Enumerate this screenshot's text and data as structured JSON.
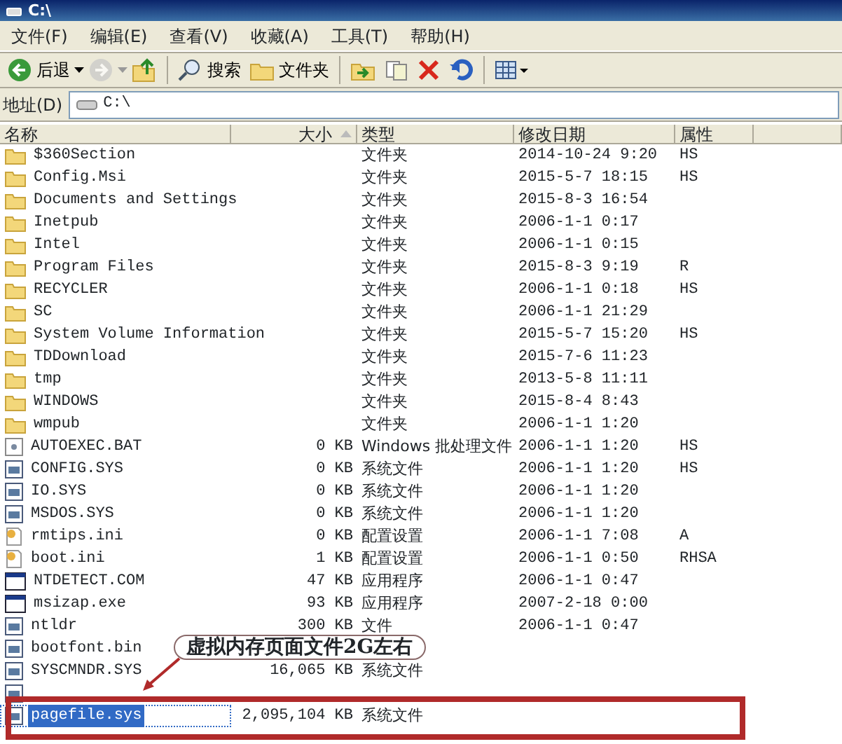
{
  "window": {
    "title": "C:\\"
  },
  "menu": [
    "文件(F)",
    "编辑(E)",
    "查看(V)",
    "收藏(A)",
    "工具(T)",
    "帮助(H)"
  ],
  "toolbar": [
    {
      "kind": "back",
      "label": "后退",
      "disabled": false
    },
    {
      "kind": "forward",
      "disabled": true
    },
    {
      "kind": "up"
    },
    {
      "kind": "sep"
    },
    {
      "kind": "search",
      "label": "搜索"
    },
    {
      "kind": "folders",
      "label": "文件夹"
    },
    {
      "kind": "sep"
    },
    {
      "kind": "moveto"
    },
    {
      "kind": "copyto"
    },
    {
      "kind": "delete"
    },
    {
      "kind": "undo"
    },
    {
      "kind": "sep"
    },
    {
      "kind": "views"
    }
  ],
  "address": {
    "label": "地址(D)",
    "value": "C:\\"
  },
  "columns": [
    "名称",
    "大小",
    "类型",
    "修改日期",
    "属性"
  ],
  "rows": [
    {
      "kind": "folder",
      "name": "$360Section",
      "type": "文件夹",
      "date": "2014-10-24 9:20",
      "attr": "HS",
      "selected": false
    },
    {
      "kind": "folder",
      "name": "Config.Msi",
      "type": "文件夹",
      "date": "2015-5-7 18:15",
      "attr": "HS",
      "selected": false
    },
    {
      "kind": "folder",
      "name": "Documents and Settings",
      "type": "文件夹",
      "date": "2015-8-3 16:54",
      "selected": false
    },
    {
      "kind": "folder",
      "name": "Inetpub",
      "type": "文件夹",
      "date": "2006-1-1 0:17",
      "selected": false
    },
    {
      "kind": "folder",
      "name": "Intel",
      "type": "文件夹",
      "date": "2006-1-1 0:15",
      "selected": false
    },
    {
      "kind": "folder",
      "name": "Program Files",
      "type": "文件夹",
      "date": "2015-8-3 9:19",
      "attr": "R",
      "selected": false
    },
    {
      "kind": "folder",
      "name": "RECYCLER",
      "type": "文件夹",
      "date": "2006-1-1 0:18",
      "attr": "HS",
      "selected": false
    },
    {
      "kind": "folder",
      "name": "SC",
      "type": "文件夹",
      "date": "2006-1-1 21:29",
      "selected": false
    },
    {
      "kind": "folder",
      "name": "System Volume Information",
      "type": "文件夹",
      "date": "2015-5-7 15:20",
      "attr": "HS",
      "selected": false
    },
    {
      "kind": "folder",
      "name": "TDDownload",
      "type": "文件夹",
      "date": "2015-7-6 11:23",
      "selected": false
    },
    {
      "kind": "folder",
      "name": "tmp",
      "type": "文件夹",
      "date": "2013-5-8 11:11",
      "selected": false
    },
    {
      "kind": "folder",
      "name": "WINDOWS",
      "type": "文件夹",
      "date": "2015-8-4 8:43",
      "selected": false
    },
    {
      "kind": "folder",
      "name": "wmpub",
      "type": "文件夹",
      "date": "2006-1-1 1:20",
      "selected": false
    },
    {
      "kind": "batch",
      "name": "AUTOEXEC.BAT",
      "size": "0 KB",
      "type": "Windows 批处理文件",
      "date": "2006-1-1 1:20",
      "attr": "HS",
      "selected": false
    },
    {
      "kind": "system",
      "name": "CONFIG.SYS",
      "size": "0 KB",
      "type": "系统文件",
      "date": "2006-1-1 1:20",
      "attr": "HS",
      "selected": false
    },
    {
      "kind": "system",
      "name": "IO.SYS",
      "size": "0 KB",
      "type": "系统文件",
      "date": "2006-1-1 1:20",
      "selected": false
    },
    {
      "kind": "system",
      "name": "MSDOS.SYS",
      "size": "0 KB",
      "type": "系统文件",
      "date": "2006-1-1 1:20",
      "selected": false
    },
    {
      "kind": "config",
      "name": "rmtips.ini",
      "size": "0 KB",
      "type": "配置设置",
      "date": "2006-1-1 7:08",
      "attr": "A",
      "selected": false
    },
    {
      "kind": "config",
      "name": "boot.ini",
      "size": "1 KB",
      "type": "配置设置",
      "date": "2006-1-1 0:50",
      "attr": "RHSA",
      "selected": false
    },
    {
      "kind": "app",
      "name": "NTDETECT.COM",
      "size": "47 KB",
      "type": "应用程序",
      "date": "2006-1-1 0:47",
      "selected": false
    },
    {
      "kind": "app",
      "name": "msizap.exe",
      "size": "93 KB",
      "type": "应用程序",
      "date": "2007-2-18 0:00",
      "selected": false
    },
    {
      "kind": "system",
      "name": "ntldr",
      "size": "300 KB",
      "type": "文件",
      "date": "2006-1-1 0:47",
      "selected": false
    },
    {
      "kind": "system",
      "name": "bootfont.bin",
      "selected": false
    },
    {
      "kind": "system",
      "name": "SYSCMNDR.SYS",
      "size": "16,065 KB",
      "type": "系统文件",
      "selected": false
    },
    {
      "kind": "system",
      "selected": false
    },
    {
      "kind": "system",
      "name": "pagefile.sys",
      "size": "2,095,104 KB",
      "type": "系统文件",
      "selected": true
    }
  ],
  "annotation": {
    "text": "虚拟内存页面文件2G左右"
  }
}
